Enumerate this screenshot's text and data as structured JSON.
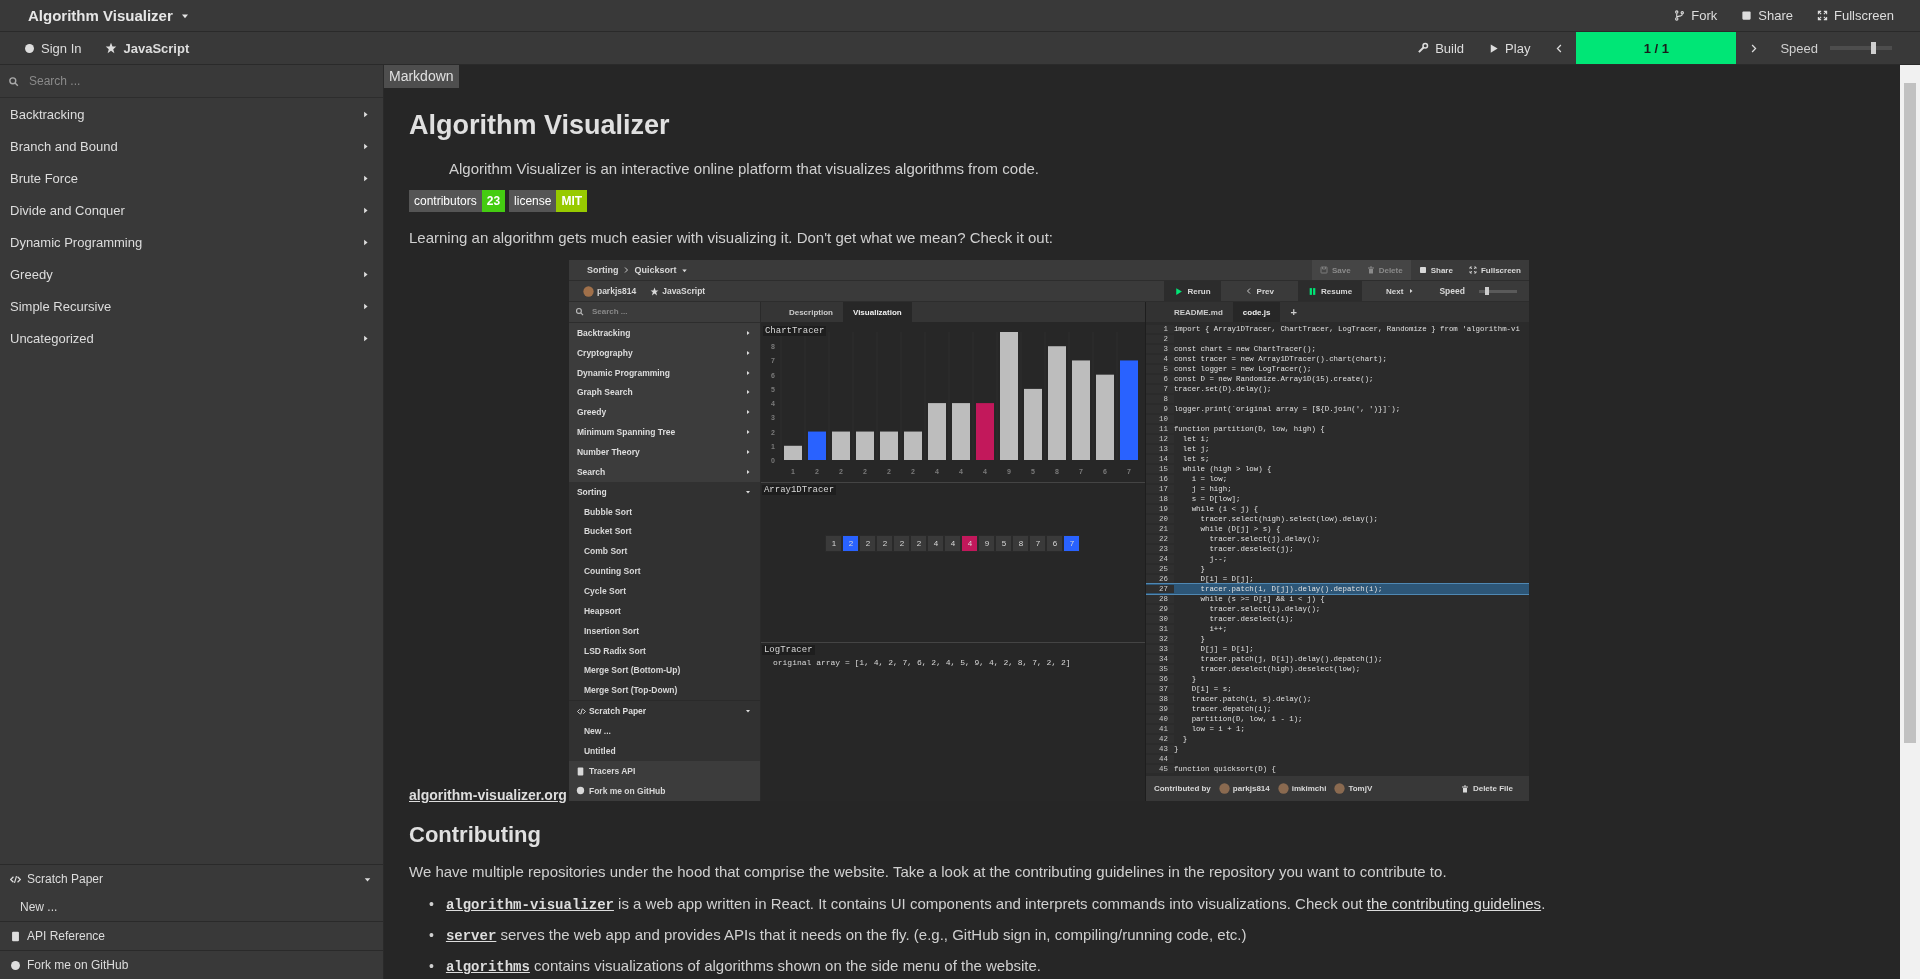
{
  "header": {
    "title": "Algorithm Visualizer",
    "actions": [
      {
        "kind": "fork",
        "label": "Fork"
      },
      {
        "kind": "share",
        "label": "Share"
      },
      {
        "kind": "fullscreen",
        "label": "Fullscreen"
      }
    ]
  },
  "toolbar": {
    "sign_in": "Sign In",
    "language": "JavaScript",
    "build": "Build",
    "play": "Play",
    "progress": {
      "text": "1 / 1",
      "level": 1
    },
    "speed": {
      "label": "Speed",
      "level": 0.7
    }
  },
  "sidebar": {
    "search": {
      "placeholder": "Search ..."
    },
    "categories": [
      {
        "label": "Backtracking",
        "expanded": false
      },
      {
        "label": "Branch and Bound",
        "expanded": false
      },
      {
        "label": "Brute Force",
        "expanded": false
      },
      {
        "label": "Divide and Conquer",
        "expanded": false
      },
      {
        "label": "Dynamic Programming",
        "expanded": false
      },
      {
        "label": "Greedy",
        "expanded": false
      },
      {
        "label": "Simple Recursive",
        "expanded": false
      },
      {
        "label": "Uncategorized",
        "expanded": false
      }
    ],
    "scratch_paper": {
      "label": "Scratch Paper",
      "expanded": true,
      "items": [
        "New ..."
      ]
    },
    "links": [
      {
        "kind": "api",
        "label": "API Reference"
      },
      {
        "kind": "github",
        "label": "Fork me on GitHub"
      }
    ]
  },
  "content": {
    "tab": "Markdown",
    "title": "Algorithm Visualizer",
    "intro": "Algorithm Visualizer is an interactive online platform that visualizes algorithms from code.",
    "badges": [
      {
        "label": "contributors",
        "value": "23",
        "color": "#44cc11"
      },
      {
        "label": "license",
        "value": "MIT",
        "color": "#97ca00"
      }
    ],
    "lead": "Learning an algorithm gets much easier with visualizing it. Don't get what we mean? Check it out:",
    "site_link": "algorithm-visualizer.org",
    "screenshot": {
      "breadcrumb": [
        "Sorting",
        "Quicksort"
      ],
      "actions": [
        {
          "kind": "save",
          "label": "Save",
          "disabled": true
        },
        {
          "kind": "delete",
          "label": "Delete",
          "disabled": true
        },
        {
          "kind": "share",
          "label": "Share",
          "disabled": false
        },
        {
          "kind": "fullscreen",
          "label": "Fullscreen",
          "disabled": false
        }
      ],
      "user": "parkjs814",
      "language": "JavaScript",
      "controls": [
        {
          "kind": "rerun",
          "label": "Rerun"
        },
        {
          "kind": "prev",
          "label": "Prev"
        },
        {
          "kind": "resume",
          "label": "Resume"
        },
        {
          "kind": "next",
          "label": "Next"
        }
      ],
      "speed": {
        "label": "Speed",
        "level": 0.2
      },
      "search": {
        "placeholder": "Search ..."
      },
      "categories": [
        {
          "label": "Backtracking",
          "expanded": false
        },
        {
          "label": "Cryptography",
          "expanded": false
        },
        {
          "label": "Dynamic Programming",
          "expanded": false
        },
        {
          "label": "Graph Search",
          "expanded": false
        },
        {
          "label": "Greedy",
          "expanded": false
        },
        {
          "label": "Minimum Spanning Tree",
          "expanded": false
        },
        {
          "label": "Number Theory",
          "expanded": false
        },
        {
          "label": "Search",
          "expanded": false
        },
        {
          "label": "Sorting",
          "expanded": true,
          "children": [
            {
              "label": "Bubble Sort"
            },
            {
              "label": "Bucket Sort"
            },
            {
              "label": "Comb Sort"
            },
            {
              "label": "Counting Sort"
            },
            {
              "label": "Cycle Sort"
            },
            {
              "label": "Heapsort"
            },
            {
              "label": "Insertion Sort"
            },
            {
              "label": "LSD Radix Sort"
            },
            {
              "label": "Merge Sort (Bottom-Up)"
            },
            {
              "label": "Merge Sort (Top-Down)"
            }
          ]
        }
      ],
      "scratch_paper": {
        "label": "Scratch Paper",
        "expanded": true,
        "items": [
          "New ...",
          "Untitled"
        ]
      },
      "links": [
        {
          "kind": "api",
          "label": "Tracers API"
        },
        {
          "kind": "github",
          "label": "Fork me on GitHub"
        }
      ],
      "view_tabs": [
        {
          "label": "Description",
          "selected": false
        },
        {
          "label": "Visualization",
          "selected": true
        }
      ],
      "chart_tracer": {
        "chart_data": {
          "type": "bar",
          "title": "ChartTracer",
          "categories": [
            "1",
            "2",
            "2",
            "2",
            "2",
            "2",
            "4",
            "4",
            "4",
            "9",
            "5",
            "8",
            "7",
            "6",
            "7"
          ],
          "stacked": true,
          "ylim": [
            0,
            9
          ],
          "yticks": [
            0,
            1,
            2,
            3,
            4,
            5,
            6,
            7,
            8
          ],
          "series": [
            {
              "color": "#bdbdbd",
              "values": [
                1,
                null,
                2,
                2,
                2,
                2,
                4,
                4,
                null,
                9,
                5,
                8,
                7,
                6,
                null
              ]
            },
            {
              "color": "#2962ff",
              "values": [
                null,
                2,
                null,
                null,
                null,
                null,
                null,
                null,
                null,
                null,
                null,
                null,
                null,
                null,
                7
              ]
            },
            {
              "color": "#c2185b",
              "values": [
                null,
                null,
                null,
                null,
                null,
                null,
                null,
                null,
                4,
                null,
                null,
                null,
                null,
                null,
                null
              ]
            }
          ]
        }
      },
      "array_tracer": {
        "title": "Array1DTracer",
        "cells": [
          {
            "value": "1",
            "selected": false,
            "patched": false
          },
          {
            "value": "2",
            "selected": true,
            "patched": false
          },
          {
            "value": "2",
            "selected": false,
            "patched": false
          },
          {
            "value": "2",
            "selected": false,
            "patched": false
          },
          {
            "value": "2",
            "selected": false,
            "patched": false
          },
          {
            "value": "2",
            "selected": false,
            "patched": false
          },
          {
            "value": "4",
            "selected": false,
            "patched": false
          },
          {
            "value": "4",
            "selected": false,
            "patched": false
          },
          {
            "value": "4",
            "selected": false,
            "patched": true
          },
          {
            "value": "9",
            "selected": false,
            "patched": false
          },
          {
            "value": "5",
            "selected": false,
            "patched": false
          },
          {
            "value": "8",
            "selected": false,
            "patched": false
          },
          {
            "value": "7",
            "selected": false,
            "patched": false
          },
          {
            "value": "6",
            "selected": false,
            "patched": false
          },
          {
            "value": "7",
            "selected": true,
            "patched": false
          }
        ]
      },
      "log_tracer": {
        "title": "LogTracer",
        "lines": [
          "original array = [1, 4, 2, 7, 6, 2, 4, 5, 9, 4, 2, 8, 7, 2, 2]"
        ]
      },
      "file_tabs": [
        {
          "label": "README.md",
          "selected": false
        },
        {
          "label": "code.js",
          "selected": true
        }
      ],
      "add_tab": "+",
      "code": [
        {
          "number": "1",
          "text": "import { Array1DTracer, ChartTracer, LogTracer, Randomize } from 'algorithm-vi",
          "highlighted": false
        },
        {
          "number": "2",
          "highlighted": false
        },
        {
          "number": "3",
          "text": "const chart = new ChartTracer();",
          "highlighted": false
        },
        {
          "number": "4",
          "text": "const tracer = new Array1DTracer().chart(chart);",
          "highlighted": false
        },
        {
          "number": "5",
          "text": "const logger = new LogTracer();",
          "highlighted": false
        },
        {
          "number": "6",
          "text": "const D = new Randomize.Array1D(15).create();",
          "highlighted": false
        },
        {
          "number": "7",
          "text": "tracer.set(D).delay();",
          "highlighted": false
        },
        {
          "number": "8",
          "highlighted": false
        },
        {
          "number": "9",
          "text": "logger.print(`original array = [${D.join(', ')}]`);",
          "highlighted": false
        },
        {
          "number": "10",
          "highlighted": false
        },
        {
          "number": "11",
          "text": "function partition(D, low, high) {",
          "highlighted": false
        },
        {
          "number": "12",
          "text": "  let i;",
          "highlighted": false
        },
        {
          "number": "13",
          "text": "  let j;",
          "highlighted": false
        },
        {
          "number": "14",
          "text": "  let s;",
          "highlighted": false
        },
        {
          "number": "15",
          "text": "  while (high > low) {",
          "highlighted": false
        },
        {
          "number": "16",
          "text": "    i = low;",
          "highlighted": false
        },
        {
          "number": "17",
          "text": "    j = high;",
          "highlighted": false
        },
        {
          "number": "18",
          "text": "    s = D[low];",
          "highlighted": false
        },
        {
          "number": "19",
          "text": "    while (i < j) {",
          "highlighted": false
        },
        {
          "number": "20",
          "text": "      tracer.select(high).select(low).delay();",
          "highlighted": false
        },
        {
          "number": "21",
          "text": "      while (D[j] > s) {",
          "highlighted": false
        },
        {
          "number": "22",
          "text": "        tracer.select(j).delay();",
          "highlighted": false
        },
        {
          "number": "23",
          "text": "        tracer.deselect(j);",
          "highlighted": false
        },
        {
          "number": "24",
          "text": "        j--;",
          "highlighted": false
        },
        {
          "number": "25",
          "text": "      }",
          "highlighted": false
        },
        {
          "number": "26",
          "text": "      D[i] = D[j];",
          "highlighted": false
        },
        {
          "number": "27",
          "text": "      tracer.patch(i, D[j]).delay().depatch(i);",
          "highlighted": true
        },
        {
          "number": "28",
          "text": "      while (s >= D[i] && i < j) {",
          "highlighted": false
        },
        {
          "number": "29",
          "text": "        tracer.select(i).delay();",
          "highlighted": false
        },
        {
          "number": "30",
          "text": "        tracer.deselect(i);",
          "highlighted": false
        },
        {
          "number": "31",
          "text": "        i++;",
          "highlighted": false
        },
        {
          "number": "32",
          "text": "      }",
          "highlighted": false
        },
        {
          "number": "33",
          "text": "      D[j] = D[i];",
          "highlighted": false
        },
        {
          "number": "34",
          "text": "      tracer.patch(j, D[i]).delay().depatch(j);",
          "highlighted": false
        },
        {
          "number": "35",
          "text": "      tracer.deselect(high).deselect(low);",
          "highlighted": false
        },
        {
          "number": "36",
          "text": "    }",
          "highlighted": false
        },
        {
          "number": "37",
          "text": "    D[i] = s;",
          "highlighted": false
        },
        {
          "number": "38",
          "text": "    tracer.patch(i, s).delay();",
          "highlighted": false
        },
        {
          "number": "39",
          "text": "    tracer.depatch(i);",
          "highlighted": false
        },
        {
          "number": "40",
          "text": "    partition(D, low, i - 1);",
          "highlighted": false
        },
        {
          "number": "41",
          "text": "    low = i + 1;",
          "highlighted": false
        },
        {
          "number": "42",
          "text": "  }",
          "highlighted": false
        },
        {
          "number": "43",
          "text": "}",
          "highlighted": false
        },
        {
          "number": "44",
          "highlighted": false
        },
        {
          "number": "45",
          "text": "function quicksort(D) {",
          "highlighted": false
        }
      ],
      "footer": {
        "label": "Contributed by",
        "contributors": [
          "parkjs814",
          "imkimchi",
          "TomjV"
        ],
        "delete": "Delete File"
      }
    },
    "section_title": "Contributing",
    "section_text": "We have multiple repositories under the hood that comprise the website. Take a look at the contributing guidelines in the repository you want to contribute to.",
    "repos": [
      {
        "marker": "•",
        "name": "algorithm-visualizer",
        "text": "is a web app written in React. It contains UI components and interprets commands into visualizations. Check out",
        "link": "the contributing guidelines",
        "tail": "."
      },
      {
        "marker": "•",
        "name": "server",
        "text": "serves the web app and provides APIs that it needs on the fly. (e.g., GitHub sign in, compiling/running code, etc.)"
      },
      {
        "marker": "•",
        "name": "algorithms",
        "text": "contains visualizations of algorithms shown on the side menu of the website."
      }
    ]
  }
}
